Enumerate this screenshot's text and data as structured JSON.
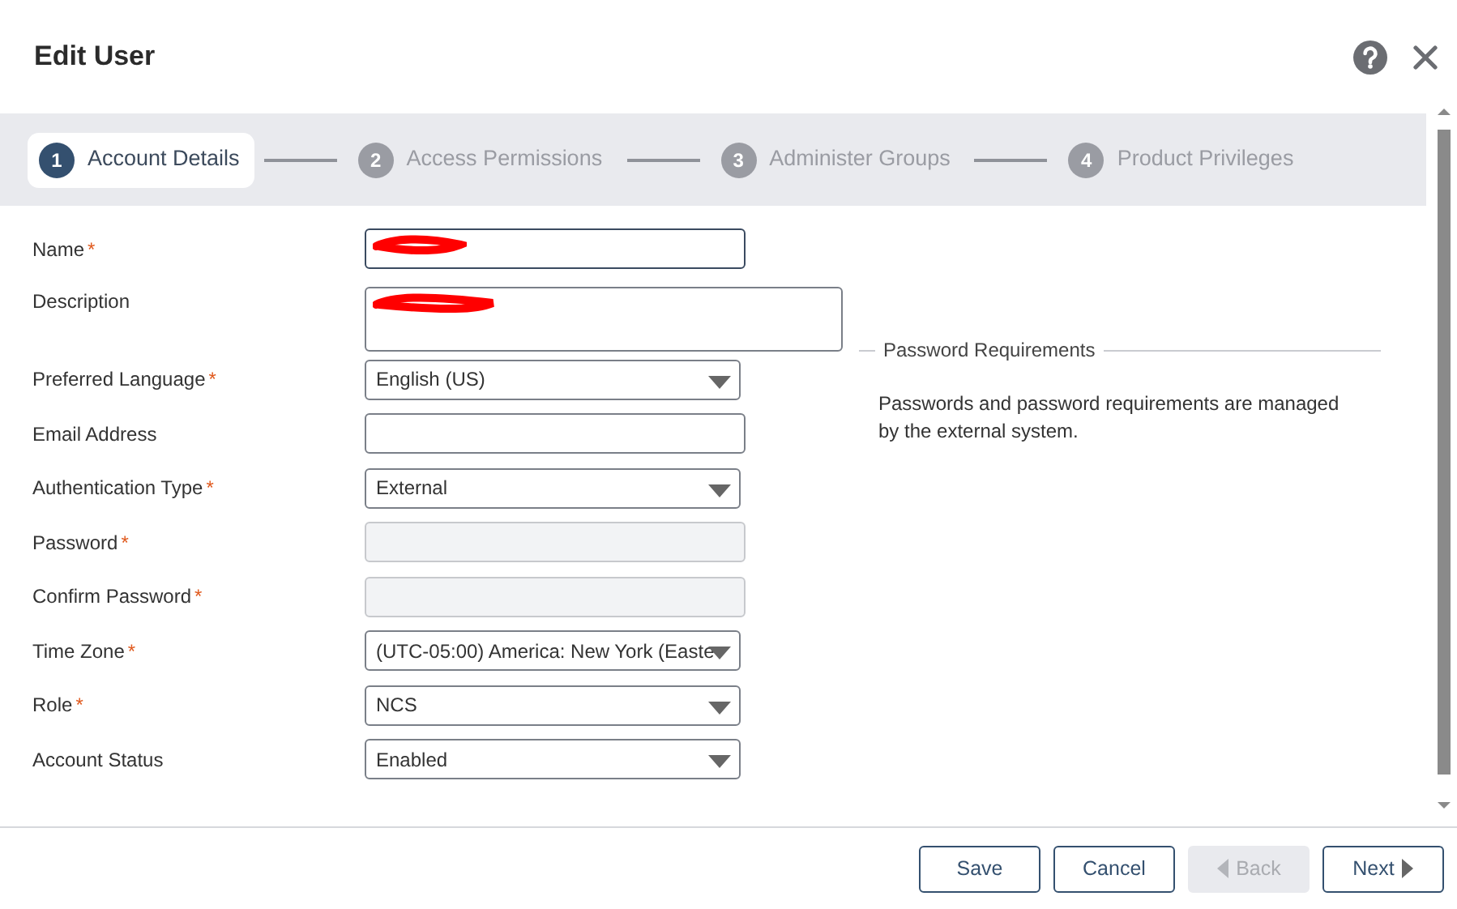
{
  "dialog": {
    "title": "Edit User"
  },
  "steps": [
    {
      "number": "1",
      "label": "Account Details",
      "selected": true
    },
    {
      "number": "2",
      "label": "Access Permissions",
      "selected": false
    },
    {
      "number": "3",
      "label": "Administer Groups",
      "selected": false
    },
    {
      "number": "4",
      "label": "Product Privileges",
      "selected": false
    }
  ],
  "fields": [
    {
      "label": "Name",
      "required": true,
      "kind": "text",
      "redacted": true
    },
    {
      "label": "Description",
      "required": false,
      "kind": "textarea",
      "redacted": true
    },
    {
      "label": "Preferred Language",
      "required": true,
      "kind": "select",
      "value": "English (US)"
    },
    {
      "label": "Email Address",
      "required": false,
      "kind": "text"
    },
    {
      "label": "Authentication Type",
      "required": true,
      "kind": "select",
      "value": "External"
    },
    {
      "label": "Password",
      "required": true,
      "kind": "text",
      "disabled": true
    },
    {
      "label": "Confirm Password",
      "required": true,
      "kind": "text",
      "disabled": true
    },
    {
      "label": "Time Zone",
      "required": true,
      "kind": "select",
      "value": "(UTC-05:00) America: New York (Easte"
    },
    {
      "label": "Role",
      "required": true,
      "kind": "select",
      "value": "NCS"
    },
    {
      "label": "Account Status",
      "required": false,
      "kind": "select",
      "value": "Enabled"
    }
  ],
  "required_mark": "*",
  "password_requirements": {
    "title": "Password Requirements",
    "text": "Passwords and password requirements are managed by the external system."
  },
  "buttons": [
    {
      "label": "Save",
      "disabled": false,
      "kind": "plain"
    },
    {
      "label": "Cancel",
      "disabled": false,
      "kind": "plain"
    },
    {
      "label": "Back",
      "disabled": true,
      "kind": "back"
    },
    {
      "label": "Next",
      "disabled": false,
      "kind": "next"
    }
  ]
}
